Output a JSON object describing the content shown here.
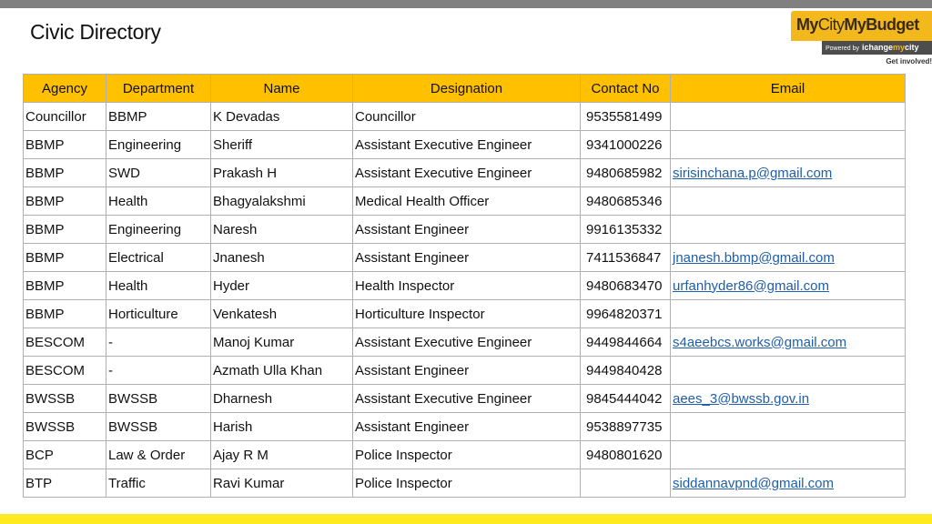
{
  "slide": {
    "title": "Civic Directory"
  },
  "logo": {
    "word_bold_1": "My",
    "word_light": "City",
    "word_bold_2": "MyBudget",
    "powered_by": "Powered by",
    "brand_1": "ichange",
    "brand_2": "my",
    "brand_3": "city",
    "tagline": "Get involved!"
  },
  "colors": {
    "header_fill": "#ffc000",
    "link": "#1f5ea8",
    "top_bar": "#808080",
    "bottom_bar": "#ffe91f"
  },
  "table": {
    "headers": [
      "Agency",
      "Department",
      "Name",
      "Designation",
      "Contact No",
      "Email"
    ],
    "rows": [
      [
        "Councillor",
        "BBMP",
        "K Devadas",
        "Councillor",
        "9535581499",
        ""
      ],
      [
        "BBMP",
        "Engineering",
        "Sheriff",
        "Assistant Executive Engineer",
        "9341000226",
        ""
      ],
      [
        "BBMP",
        "SWD",
        "Prakash H",
        "Assistant Executive Engineer",
        "9480685982",
        "sirisinchana.p@gmail.com"
      ],
      [
        "BBMP",
        "Health",
        "Bhagyalakshmi",
        "Medical Health Officer",
        "9480685346",
        ""
      ],
      [
        "BBMP",
        "Engineering",
        "Naresh",
        "Assistant Engineer",
        "9916135332",
        ""
      ],
      [
        "BBMP",
        "Electrical",
        "Jnanesh",
        "Assistant Engineer",
        "7411536847",
        "jnanesh.bbmp@gmail.com"
      ],
      [
        "BBMP",
        "Health",
        "Hyder",
        "Health Inspector",
        "9480683470",
        "urfanhyder86@gmail.com"
      ],
      [
        "BBMP",
        "Horticulture",
        "Venkatesh",
        "Horticulture Inspector",
        "9964820371",
        ""
      ],
      [
        "BESCOM",
        "-",
        "Manoj Kumar",
        "Assistant Executive Engineer",
        "9449844664",
        "s4aeebcs.works@gmail.com"
      ],
      [
        "BESCOM",
        "-",
        "Azmath Ulla Khan",
        "Assistant Engineer",
        "9449840428",
        ""
      ],
      [
        "BWSSB",
        "BWSSB",
        "Dharnesh",
        "Assistant Executive Engineer",
        "9845444042",
        "aees_3@bwssb.gov.in"
      ],
      [
        "BWSSB",
        "BWSSB",
        "Harish",
        "Assistant Engineer",
        "9538897735",
        ""
      ],
      [
        "BCP",
        "Law & Order",
        "Ajay R M",
        "Police Inspector",
        "9480801620",
        ""
      ],
      [
        "BTP",
        "Traffic",
        "Ravi Kumar",
        "Police Inspector",
        "",
        "siddannavpnd@gmail.com"
      ]
    ]
  }
}
